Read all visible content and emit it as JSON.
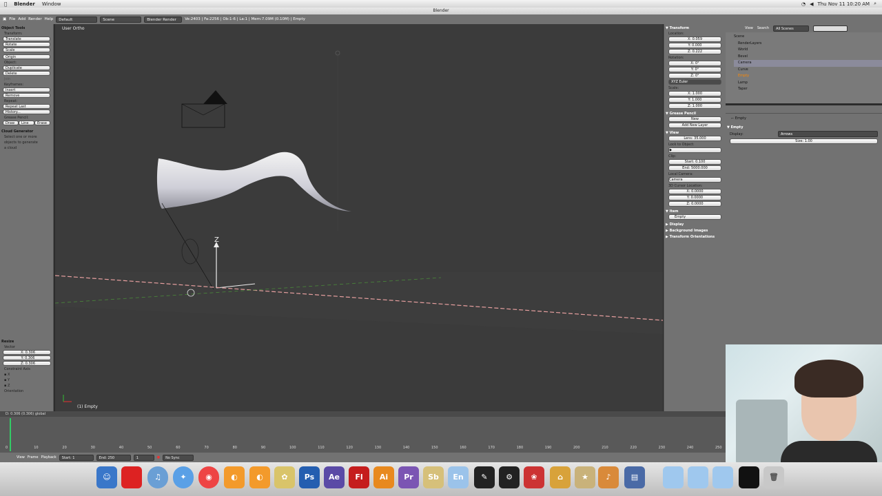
{
  "menubar": {
    "app_name": "Blender",
    "window_menu": "Window",
    "clock": "Thu Nov 11  10:20 AM"
  },
  "window_title": "Blender",
  "header": {
    "menus": [
      "File",
      "Add",
      "Render",
      "Help"
    ],
    "layout": "Default",
    "scene": "Scene",
    "engine": "Blender Render",
    "stats": "Ve:2403 | Fa:2256 | Ob:1-6 | La:1 | Mem:7.09M (0.10M) | Empty"
  },
  "toolshelf": {
    "title": "Object Tools",
    "transform_label": "Transform:",
    "transform_buttons": [
      "Translate",
      "Rotate",
      "Scale"
    ],
    "origin_button": "Origin",
    "object_label": "Object:",
    "object_buttons": [
      "Duplicate",
      "Delete",
      "Join"
    ],
    "keyframes_label": "Keyframes:",
    "keyframe_buttons": [
      "Insert",
      "Remove"
    ],
    "repeat_label": "Repeat:",
    "repeat_buttons": [
      "Repeat Last",
      "History..."
    ],
    "grease_label": "Grease Pencil:",
    "grease_buttons": [
      "Draw",
      "Line",
      "Erase"
    ],
    "cloud_title": "Cloud Generator",
    "cloud_text": [
      "Select one or more",
      "objects to generate",
      "a cloud"
    ],
    "resize_title": "Resize",
    "vector_label": "Vector",
    "vector": [
      "X: 0.306",
      "Y: 0.306",
      "Z: 0.306"
    ],
    "constraint_label": "Constraint Axis",
    "axes": [
      "X",
      "Y",
      "Z"
    ],
    "orientation_label": "Orientation"
  },
  "viewport": {
    "label": "User Ortho",
    "object_label": "(1) Empty",
    "status": "D: 0.306 (0.306) global"
  },
  "npanel": {
    "transform_title": "Transform",
    "location_label": "Location:",
    "location": [
      "X: 0.059",
      "Y: 0.000",
      "Z: 0.222"
    ],
    "rotation_label": "Rotation:",
    "rotation": [
      "X: 0°",
      "Y: 0°",
      "Z: 0°"
    ],
    "rotation_mode": "XYZ Euler",
    "scale_label": "Scale:",
    "scale": [
      "X: 1.000",
      "Y: 1.000",
      "Z: 1.000"
    ],
    "grease_title": "Grease Pencil",
    "grease_new": "New",
    "add_layer": "Add New Layer",
    "view_title": "View",
    "lens": "Lens: 35.000",
    "lock_label": "Lock to Object:",
    "clip_label": "Clip:",
    "clip_start": "Start: 0.100",
    "clip_end": "End: 5000.000",
    "local_camera_label": "Local Camera:",
    "camera": "Camera",
    "cursor_label": "3D Cursor Location:",
    "cursor": [
      "X: 0.0000",
      "Y: 0.0000",
      "Z: 0.0000"
    ],
    "item_title": "Item",
    "item_name": "Empty",
    "display_title": "Display",
    "bg_images": "Background Images",
    "transform_orient": "Transform Orientations"
  },
  "outliner": {
    "menus": [
      "View",
      "Search"
    ],
    "scope": "All Scenes",
    "items": [
      "Scene",
      "RenderLayers",
      "World",
      "Bevel",
      "Camera",
      "Curve",
      "Empty",
      "Lamp",
      "Taper"
    ]
  },
  "props": {
    "object": "Empty",
    "panel_title": "Empty",
    "display_label": "Display:",
    "display_value": "Arrows",
    "size": "Size: 1.00"
  },
  "timeline": {
    "menus": [
      "View",
      "Frame",
      "Playback"
    ],
    "start": "Start: 1",
    "end": "End: 250",
    "current": "1",
    "sync": "No Sync",
    "ticks": [
      "0",
      "10",
      "20",
      "30",
      "40",
      "50",
      "60",
      "70",
      "80",
      "90",
      "100",
      "110",
      "120",
      "130",
      "140",
      "150",
      "160",
      "170",
      "180",
      "190",
      "200",
      "210",
      "220",
      "230",
      "240",
      "250"
    ]
  },
  "dock": {
    "labels": [
      "Ps",
      "Ae",
      "Fl",
      "Ai",
      "Pr",
      "Sb",
      "En"
    ]
  }
}
